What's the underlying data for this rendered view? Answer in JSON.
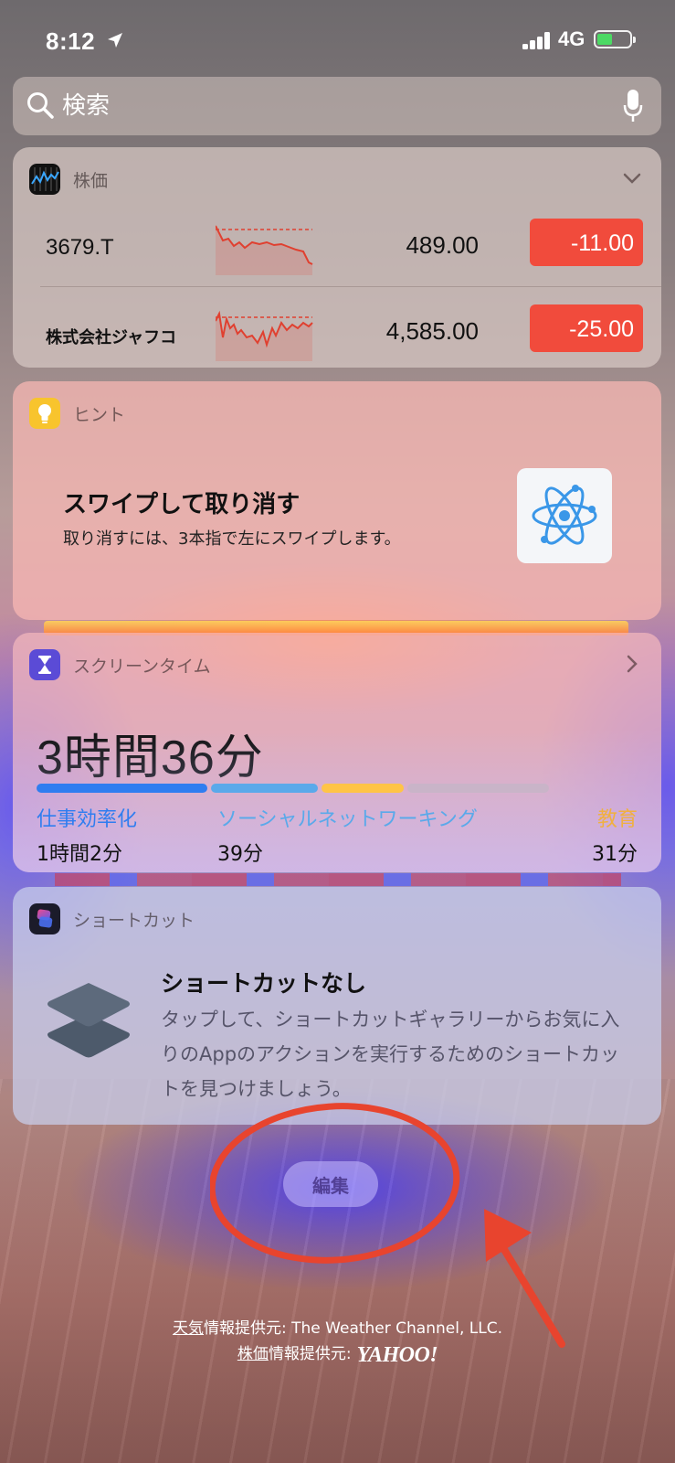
{
  "status": {
    "time": "8:12",
    "network": "4G",
    "battery_color": "#4cd964"
  },
  "search": {
    "placeholder": "検索",
    "icon": "search-icon",
    "mic_icon": "microphone-icon"
  },
  "stocks": {
    "title": "株価",
    "icon": "stocks-app-icon",
    "rows": [
      {
        "symbol": "3679.T",
        "price": "489.00",
        "change": "-11.00"
      },
      {
        "symbol": "株式会社ジャフコ",
        "price": "4,585.00",
        "change": "-25.00"
      }
    ],
    "change_color": "#f14b3c"
  },
  "tips": {
    "title": "ヒント",
    "icon": "lightbulb-icon",
    "heading": "スワイプして取り消す",
    "body": "取り消すには、3本指で左にスワイプします。",
    "art_icon": "atom-icon"
  },
  "screentime": {
    "title": "スクリーンタイム",
    "icon": "hourglass-icon",
    "total": "3時間36分",
    "categories": [
      {
        "name": "仕事効率化",
        "time": "1時間2分",
        "color": "#2f7df0",
        "fraction": 0.29
      },
      {
        "name": "ソーシャルネットワーキング",
        "time": "39分",
        "color": "#5aa9ea",
        "fraction": 0.18
      },
      {
        "name": "教育",
        "time": "31分",
        "color": "#ffc446",
        "fraction": 0.14
      }
    ],
    "remainder_color": "#c9b4c8"
  },
  "shortcuts": {
    "title": "ショートカット",
    "icon": "shortcuts-app-icon",
    "heading": "ショートカットなし",
    "body": "タップして、ショートカットギャラリーからお気に入りのAppのアクションを実行するためのショートカットを見つけましょう。",
    "art_icon": "layers-icon"
  },
  "edit_button": "編集",
  "footer": {
    "weather_underlined": "天気",
    "weather_rest": "情報提供元: The Weather Channel, LLC.",
    "stocks_underlined": "株価",
    "stocks_rest": "情報提供元:",
    "yahoo": "YAHOO!"
  }
}
